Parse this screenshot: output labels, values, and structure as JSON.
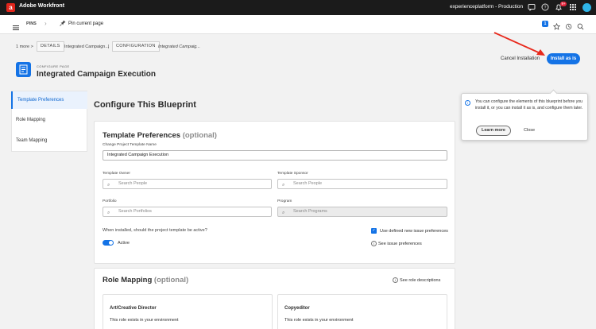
{
  "topbar": {
    "app_title": "Adobe Workfront",
    "instance": "experienceplatform - Production",
    "notification_count": "9+",
    "logo_letter": "a"
  },
  "pinsbar": {
    "pins_label": "PINS",
    "pin_current": "Pin current page",
    "counter": "1"
  },
  "breadcrumb": {
    "more": "1 more",
    "details_label": "DETAILS",
    "details_value": "Integrated Campaign...",
    "separator": "|",
    "config_label": "CONFIGURATION",
    "config_value": "Integrated Campaig..."
  },
  "header": {
    "eyebrow": "CONFIGURE PAGE",
    "title": "Integrated Campaign Execution",
    "cancel_label": "Cancel Installation",
    "install_label": "Install as is"
  },
  "leftnav": {
    "items": [
      {
        "label": "Template Preferences"
      },
      {
        "label": "Role Mapping"
      },
      {
        "label": "Team Mapping"
      }
    ]
  },
  "main": {
    "title": "Configure This Blueprint"
  },
  "template_prefs": {
    "title": "Template Preferences",
    "optional": "(optional)",
    "change_name_label": "Change Project Template Name",
    "change_name_value": "Integrated Campaign Execution",
    "owner_label": "Template Owner",
    "owner_placeholder": "Search People",
    "sponsor_label": "Template Sponsor",
    "sponsor_placeholder": "Search People",
    "portfolio_label": "Portfolio",
    "portfolio_placeholder": "Search Portfolios",
    "program_label": "Program",
    "program_placeholder": "Search Programs",
    "active_question": "When installed, should the project template be active?",
    "active_label": "Active",
    "use_issue_prefs": "Use defined new issue preferences",
    "see_issue_prefs": "See issue preferences"
  },
  "role_mapping": {
    "title": "Role Mapping",
    "optional": "(optional)",
    "see_roles": "See role descriptions",
    "roles": [
      {
        "name": "Art/Creative Director",
        "status": "This role exists in your environment"
      },
      {
        "name": "Copyeditor",
        "status": "This role exists in your environment"
      }
    ]
  },
  "popover": {
    "text": "You can configure the elements of this blueprint before you install it, or you can install it as is, and configure them later.",
    "learn_more": "Learn more",
    "close": "Close"
  },
  "colors": {
    "accent": "#1473e6",
    "topbar": "#1b1b1b",
    "annotation_arrow": "#e8291c"
  }
}
